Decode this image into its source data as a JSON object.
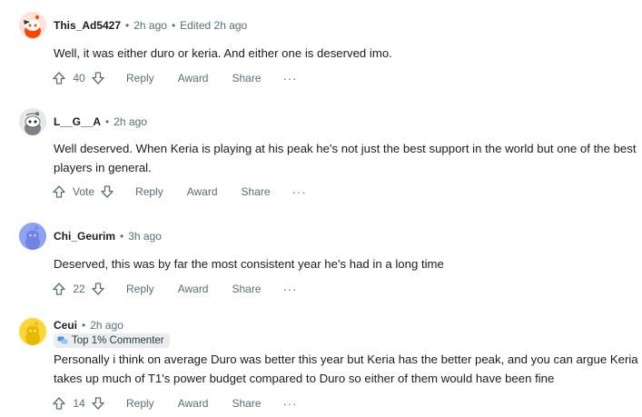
{
  "comments": [
    {
      "username": "This_Ad5427",
      "age": "2h ago",
      "edited": "Edited 2h ago",
      "flair": "",
      "body": "Well, it was either duro or keria. And either one is deserved imo.",
      "votes": "40",
      "avatar": "orange-snoo"
    },
    {
      "username": "L__G__A",
      "age": "2h ago",
      "edited": "",
      "flair": "",
      "body": "Well deserved. When Keria is playing at his peak he's not just the best support in the world but one of the best players in general.",
      "votes": "Vote",
      "avatar": "gray-snoo"
    },
    {
      "username": "Chi_Geurim",
      "age": "3h ago",
      "edited": "",
      "flair": "",
      "body": "Deserved, this was by far the most consistent year he's had in a long time",
      "votes": "22",
      "avatar": "blue-snoo"
    },
    {
      "username": "Ceui",
      "age": "2h ago",
      "edited": "",
      "flair": "Top 1% Commenter",
      "body": "Personally i think on average Duro was better this year but Keria has the better peak, and you can argue Keria takes up much of T1's power budget compared to Duro so either of them would have been fine",
      "votes": "14",
      "avatar": "yellow-snoo"
    }
  ],
  "actions": {
    "reply": "Reply",
    "award": "Award",
    "share": "Share",
    "more": "···"
  },
  "separator": "•",
  "colors": {
    "meta": "#576f76",
    "text": "#1c1c1c",
    "flair_bg": "#eaedef"
  }
}
